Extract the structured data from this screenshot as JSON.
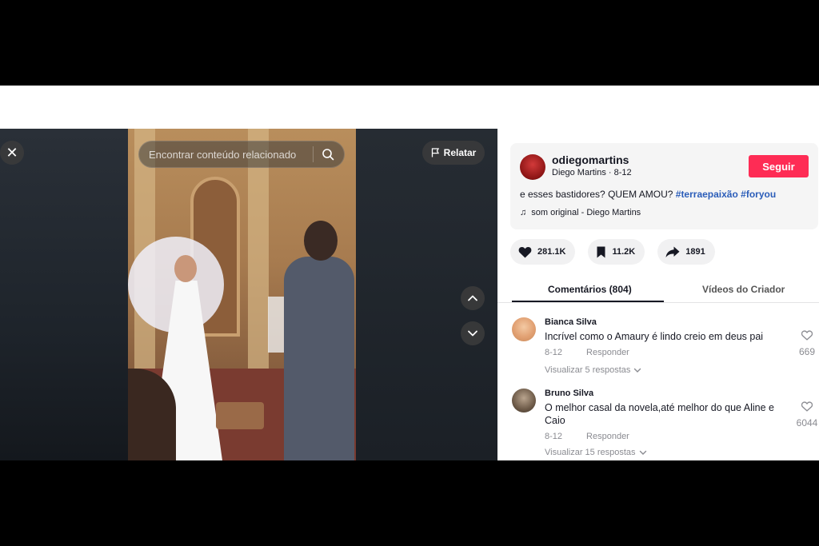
{
  "player": {
    "search_placeholder": "Encontrar conteúdo relacionado",
    "report_label": "Relatar"
  },
  "author": {
    "username": "odiegomartins",
    "display_name": "Diego Martins",
    "date": "8-12",
    "follow_label": "Seguir"
  },
  "post": {
    "caption_text": "e esses bastidores? QUEM AMOU?",
    "hashtag_1": "#terraepaixão",
    "hashtag_2": "#foryou",
    "music": "som original - Diego Martins"
  },
  "stats": {
    "likes": "281.1K",
    "saves": "11.2K",
    "shares": "1891"
  },
  "tabs": {
    "comments": "Comentários (804)",
    "creator_videos": "Vídeos do Criador"
  },
  "comments": [
    {
      "name": "Bianca Silva",
      "text": "Incrível como o Amaury é lindo creio em deus pai",
      "date": "8-12",
      "reply_label": "Responder",
      "view_replies": "Visualizar 5 respostas",
      "likes": "669"
    },
    {
      "name": "Bruno Silva",
      "text": "O melhor casal da novela,até melhor do que Aline e Caio",
      "date": "8-12",
      "reply_label": "Responder",
      "view_replies": "Visualizar 15 respostas",
      "likes": "6044"
    }
  ],
  "colors": {
    "follow": "#fe2c55",
    "hashtag": "#2b5db9"
  }
}
